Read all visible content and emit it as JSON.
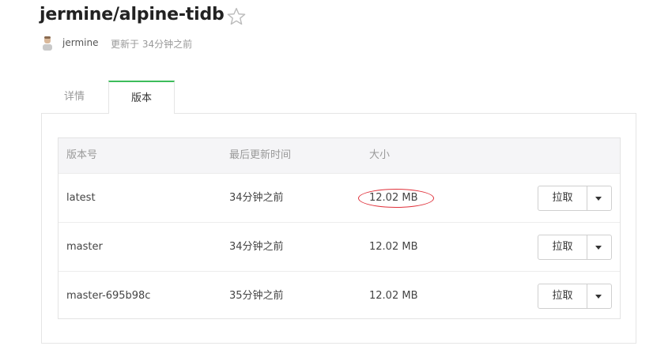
{
  "repo": {
    "title": "jermine/alpine-tidb",
    "author": "jermine",
    "updated": "更新于 34分钟之前"
  },
  "icons": {
    "star": "star-outline-icon",
    "avatar": "user-avatar",
    "dropdown": "caret-down-icon"
  },
  "tabs": [
    {
      "label": "详情",
      "active": false
    },
    {
      "label": "版本",
      "active": true
    }
  ],
  "table": {
    "headers": [
      "版本号",
      "最后更新时间",
      "大小"
    ],
    "rows": [
      {
        "version": "latest",
        "updated": "34分钟之前",
        "size": "12.02 MB",
        "action": "拉取",
        "size_highlighted": true
      },
      {
        "version": "master",
        "updated": "34分钟之前",
        "size": "12.02 MB",
        "action": "拉取",
        "size_highlighted": false
      },
      {
        "version": "master-695b98c",
        "updated": "35分钟之前",
        "size": "12.02 MB",
        "action": "拉取",
        "size_highlighted": false
      }
    ]
  },
  "colors": {
    "active_tab_accent": "#3dbd5b",
    "annotation_circle": "#e0303a"
  }
}
